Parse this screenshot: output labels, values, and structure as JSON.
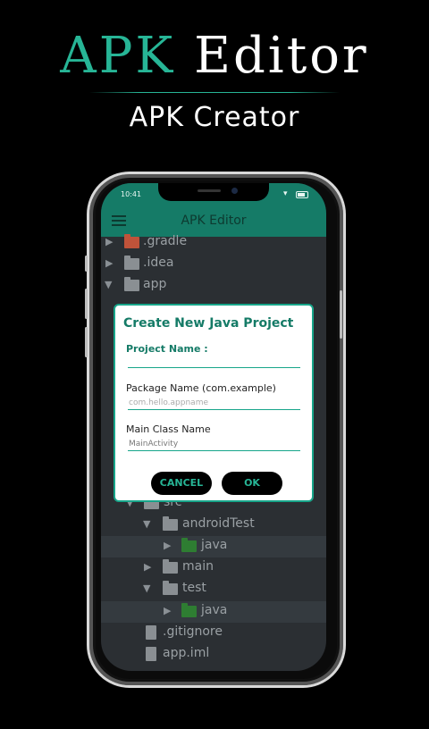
{
  "hero": {
    "title_accent": "APK",
    "title_rest": "Editor",
    "subtitle": "APK Creator"
  },
  "status_bar": {
    "time": "10:41"
  },
  "app_bar": {
    "title": "APK Editor",
    "menu_icon": "hamburger-menu-icon"
  },
  "tree": {
    "items": [
      {
        "label": ".gradle",
        "type": "folder",
        "color": "#c0533a"
      },
      {
        "label": ".idea",
        "type": "folder"
      },
      {
        "label": "app",
        "type": "folder",
        "expanded": true
      },
      {
        "label": "src",
        "type": "folder",
        "expanded": true
      },
      {
        "label": "androidTest",
        "type": "folder",
        "expanded": true
      },
      {
        "label": "java",
        "type": "folder",
        "color": "#2e7d32"
      },
      {
        "label": "main",
        "type": "folder"
      },
      {
        "label": "test",
        "type": "folder",
        "expanded": true
      },
      {
        "label": "java",
        "type": "folder",
        "color": "#2e7d32"
      },
      {
        "label": ".gitignore",
        "type": "file"
      },
      {
        "label": "app.iml",
        "type": "file"
      }
    ]
  },
  "dialog": {
    "title": "Create New Java Project",
    "project_name_label": "Project Name :",
    "project_name_value": "",
    "package_label": "Package Name (com.example)",
    "package_placeholder": "com.hello.appname",
    "main_class_label": "Main Class Name",
    "main_class_value": "MainActivity",
    "cancel_label": "CANCEL",
    "ok_label": "OK"
  },
  "colors": {
    "accent": "#27b596",
    "app_bar": "#157b67",
    "background": "#000000"
  }
}
